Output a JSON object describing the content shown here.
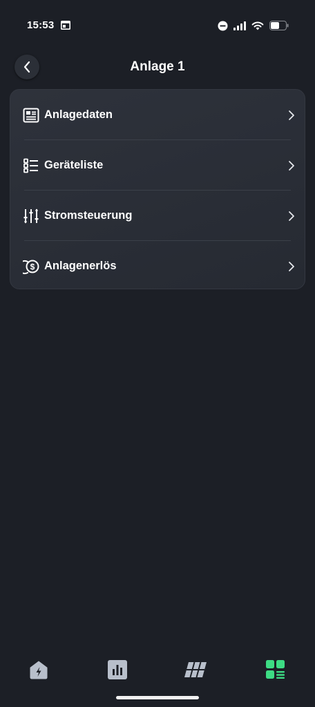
{
  "status_bar": {
    "time": "15:53"
  },
  "header": {
    "title": "Anlage 1"
  },
  "menu": {
    "items": [
      {
        "label": "Anlagedaten",
        "icon": "document-icon"
      },
      {
        "label": "Geräteliste",
        "icon": "list-icon"
      },
      {
        "label": "Stromsteuerung",
        "icon": "sliders-icon"
      },
      {
        "label": "Anlagenerlös",
        "icon": "coins-icon"
      }
    ]
  },
  "bottom_nav": {
    "items": [
      {
        "icon": "home-energy-icon",
        "active": false
      },
      {
        "icon": "bar-chart-icon",
        "active": false
      },
      {
        "icon": "solar-panel-icon",
        "active": false
      },
      {
        "icon": "dashboard-grid-icon",
        "active": true
      }
    ]
  },
  "colors": {
    "background": "#1c1f26",
    "card": "#2c3038",
    "accent": "#3ddc84",
    "inactive_icon": "#b8bfcb"
  }
}
